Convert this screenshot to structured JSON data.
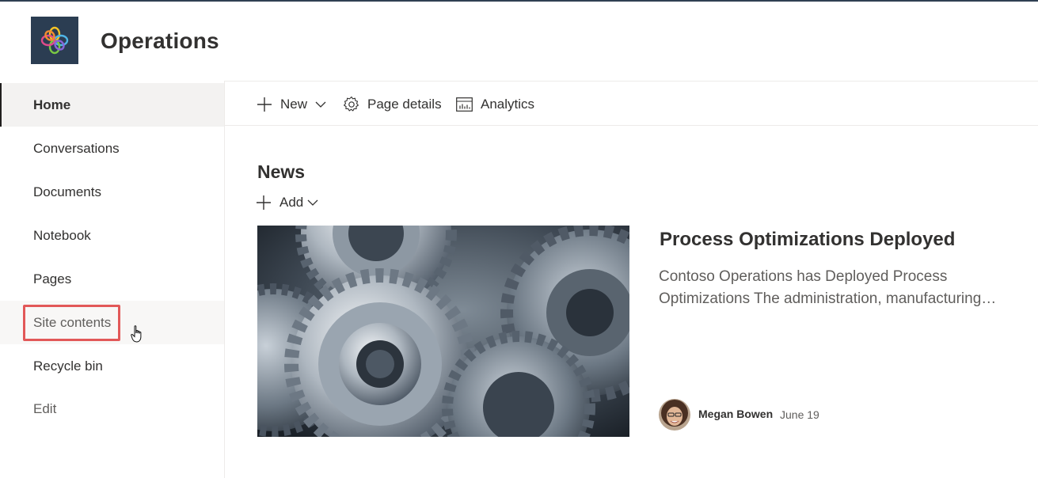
{
  "site": {
    "title": "Operations",
    "logo_icon": "site-logo-icon",
    "accent_color": "#2b3d52"
  },
  "nav": {
    "items": [
      {
        "label": "Home",
        "state": "selected"
      },
      {
        "label": "Conversations"
      },
      {
        "label": "Documents"
      },
      {
        "label": "Notebook"
      },
      {
        "label": "Pages"
      },
      {
        "label": "Site contents",
        "state": "hover-highlighted"
      },
      {
        "label": "Recycle bin"
      },
      {
        "label": "Edit",
        "state": "muted"
      }
    ],
    "highlight_color": "#e25858"
  },
  "commandbar": {
    "new_label": "New",
    "page_details_label": "Page details",
    "analytics_label": "Analytics",
    "icons": [
      "plus-icon",
      "chevron-down-icon",
      "gear-icon",
      "analytics-icon"
    ]
  },
  "news": {
    "title": "News",
    "add_label": "Add",
    "article": {
      "image": "gears-photo",
      "title": "Process Optimizations Deployed",
      "desc_line1": "Contoso Operations has Deployed Process",
      "desc_line2": "Optimizations The administration, manufacturing…",
      "author": "Megan Bowen",
      "date": "June 19"
    }
  }
}
